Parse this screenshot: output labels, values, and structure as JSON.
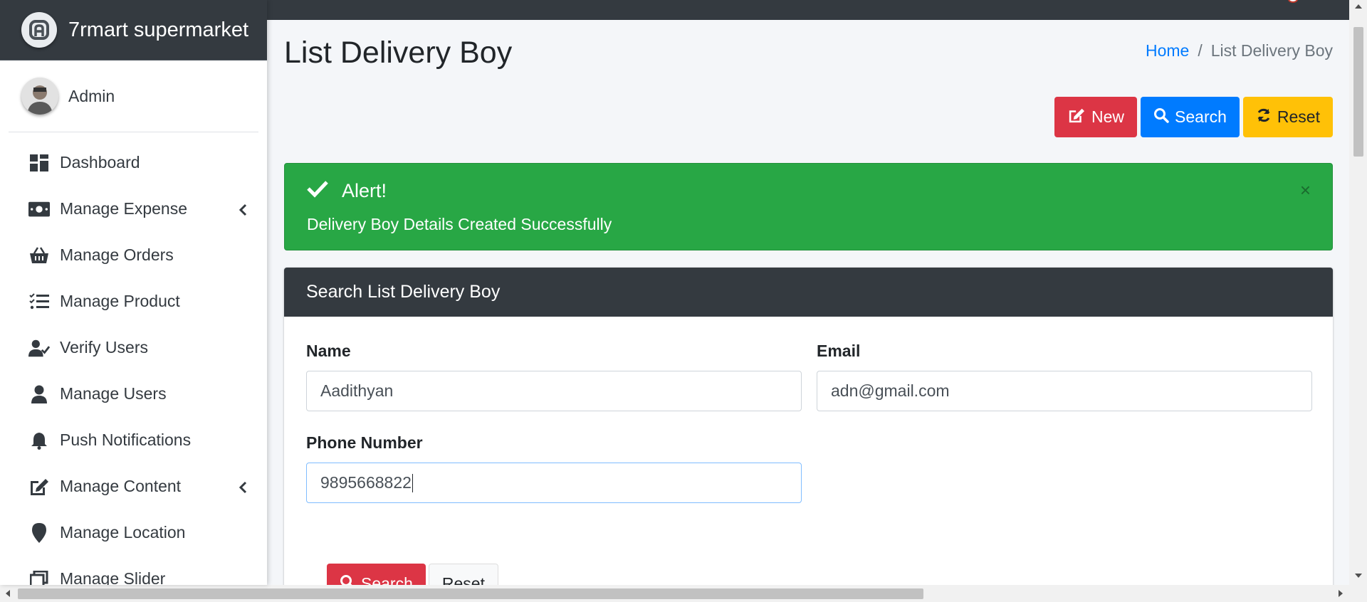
{
  "brand": {
    "name": "7rmart supermarket"
  },
  "user": {
    "name": "Admin"
  },
  "sidebar": {
    "items": [
      {
        "label": "Dashboard",
        "icon": "dashboard-icon"
      },
      {
        "label": "Manage Expense",
        "icon": "money-icon"
      },
      {
        "label": "Manage Orders",
        "icon": "basket-icon"
      },
      {
        "label": "Manage Product",
        "icon": "tasks-icon"
      },
      {
        "label": "Verify Users",
        "icon": "user-check-icon"
      },
      {
        "label": "Manage Users",
        "icon": "user-icon"
      },
      {
        "label": "Push Notifications",
        "icon": "bell-icon"
      },
      {
        "label": "Manage Content",
        "icon": "edit-icon"
      },
      {
        "label": "Manage Location",
        "icon": "map-marker-icon"
      },
      {
        "label": "Manage Slider",
        "icon": "slider-icon"
      }
    ]
  },
  "page": {
    "title": "List Delivery Boy",
    "breadcrumb": {
      "home": "Home",
      "separator": "/",
      "current": "List Delivery Boy"
    }
  },
  "actions": {
    "new_label": "New",
    "search_label": "Search",
    "reset_label": "Reset"
  },
  "alert": {
    "title": "Alert!",
    "message": "Delivery Boy Details Created Successfully",
    "close": "×"
  },
  "search_form": {
    "header": "Search List Delivery Boy",
    "name_label": "Name",
    "name_value": "Aadithyan",
    "email_label": "Email",
    "email_value": "adn@gmail.com",
    "phone_label": "Phone Number",
    "phone_value": "9895668822",
    "search_label": "Search",
    "reset_label": "Reset"
  },
  "colors": {
    "danger": "#dc3545",
    "primary": "#007bff",
    "warning": "#ffc107",
    "success": "#28a745",
    "dark": "#343a40"
  }
}
